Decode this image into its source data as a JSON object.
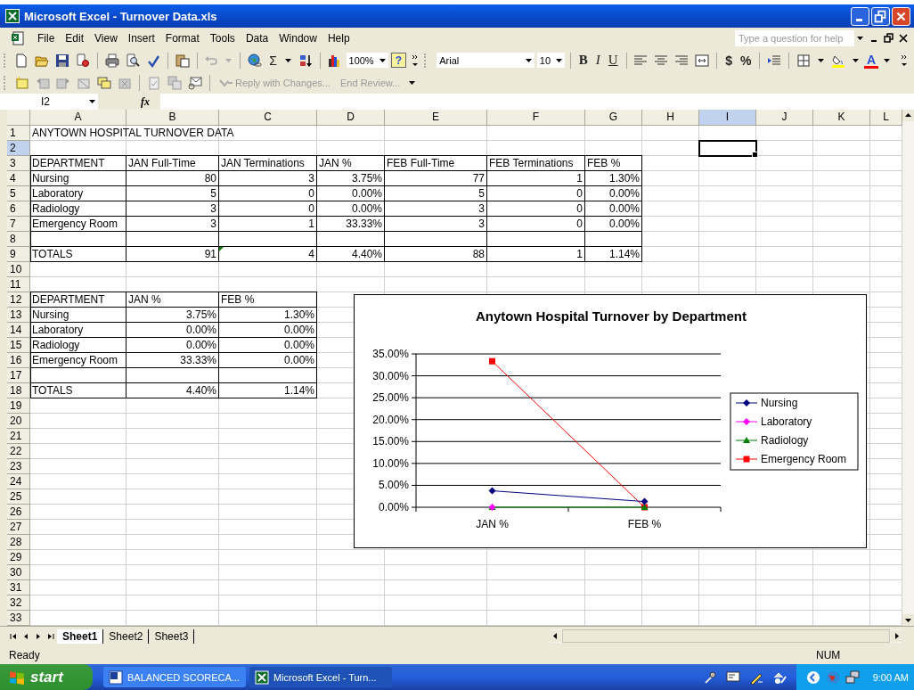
{
  "window": {
    "title": "Microsoft Excel - Turnover Data.xls"
  },
  "menu": [
    "File",
    "Edit",
    "View",
    "Insert",
    "Format",
    "Tools",
    "Data",
    "Window",
    "Help"
  ],
  "help_box": {
    "placeholder": "Type a question for help"
  },
  "standard_toolbar": {
    "sum_glyph": "Σ",
    "zoom": "100%",
    "help_glyph": "?"
  },
  "formatting_toolbar": {
    "font": "Arial",
    "size": "10",
    "bold_glyph": "B",
    "italic_glyph": "I",
    "underline_glyph": "U",
    "currency_glyph": "$",
    "percent_glyph": "%",
    "font_color_glyph": "A"
  },
  "reviewing_toolbar": {
    "buttons": [
      {
        "label": "Reply with Changes...",
        "disabled": true
      },
      {
        "label": "End Review...",
        "disabled": true
      }
    ]
  },
  "formula_bar": {
    "name_box": "I2",
    "fx": "fx"
  },
  "columns": [
    {
      "label": "A",
      "selected": false
    },
    {
      "label": "B",
      "selected": false
    },
    {
      "label": "C",
      "selected": false
    },
    {
      "label": "D",
      "selected": false
    },
    {
      "label": "E",
      "selected": false
    },
    {
      "label": "F",
      "selected": false
    },
    {
      "label": "G",
      "selected": false
    },
    {
      "label": "H",
      "selected": false
    },
    {
      "label": "I",
      "selected": true
    },
    {
      "label": "J",
      "selected": false
    },
    {
      "label": "K",
      "selected": false
    },
    {
      "label": "L",
      "selected": false
    }
  ],
  "rows": [
    {
      "number": "1",
      "selected": false,
      "bordered": false,
      "cells": [
        {
          "value": "ANYTOWN HOSPITAL TURNOVER DATA",
          "kind": "text"
        }
      ]
    },
    {
      "number": "2",
      "selected": true,
      "bordered": false
    },
    {
      "number": "3",
      "selected": false,
      "bordered": true,
      "cells": [
        {
          "value": "DEPARTMENT",
          "kind": "text"
        },
        {
          "value": "JAN Full-Time",
          "kind": "text"
        },
        {
          "value": "JAN Terminations",
          "kind": "text"
        },
        {
          "value": "JAN %",
          "kind": "text"
        },
        {
          "value": "FEB Full-Time",
          "kind": "text"
        },
        {
          "value": "FEB Terminations",
          "kind": "text"
        },
        {
          "value": "FEB %",
          "kind": "text"
        }
      ]
    },
    {
      "number": "4",
      "selected": false,
      "bordered": true,
      "cells": [
        {
          "value": "Nursing",
          "kind": "text"
        },
        {
          "value": "80",
          "kind": "number"
        },
        {
          "value": "3",
          "kind": "number"
        },
        {
          "value": "3.75%",
          "kind": "number"
        },
        {
          "value": "77",
          "kind": "number"
        },
        {
          "value": "1",
          "kind": "number"
        },
        {
          "value": "1.30%",
          "kind": "number"
        }
      ]
    },
    {
      "number": "5",
      "selected": false,
      "bordered": true,
      "cells": [
        {
          "value": "Laboratory",
          "kind": "text"
        },
        {
          "value": "5",
          "kind": "number"
        },
        {
          "value": "0",
          "kind": "number"
        },
        {
          "value": "0.00%",
          "kind": "number"
        },
        {
          "value": "5",
          "kind": "number"
        },
        {
          "value": "0",
          "kind": "number"
        },
        {
          "value": "0.00%",
          "kind": "number"
        }
      ]
    },
    {
      "number": "6",
      "selected": false,
      "bordered": true,
      "cells": [
        {
          "value": "Radiology",
          "kind": "text"
        },
        {
          "value": "3",
          "kind": "number"
        },
        {
          "value": "0",
          "kind": "number"
        },
        {
          "value": "0.00%",
          "kind": "number"
        },
        {
          "value": "3",
          "kind": "number"
        },
        {
          "value": "0",
          "kind": "number"
        },
        {
          "value": "0.00%",
          "kind": "number"
        }
      ]
    },
    {
      "number": "7",
      "selected": false,
      "bordered": true,
      "cells": [
        {
          "value": "Emergency Room",
          "kind": "text"
        },
        {
          "value": "3",
          "kind": "number"
        },
        {
          "value": "1",
          "kind": "number"
        },
        {
          "value": "33.33%",
          "kind": "number"
        },
        {
          "value": "3",
          "kind": "number"
        },
        {
          "value": "0",
          "kind": "number"
        },
        {
          "value": "0.00%",
          "kind": "number"
        }
      ]
    },
    {
      "number": "8",
      "selected": false,
      "bordered": true
    },
    {
      "number": "9",
      "selected": false,
      "bordered": true,
      "cells": [
        {
          "value": "TOTALS",
          "kind": "text"
        },
        {
          "value": "91",
          "kind": "number"
        },
        {
          "value": "4",
          "kind": "number",
          "error_flag": true
        },
        {
          "value": "4.40%",
          "kind": "number"
        },
        {
          "value": "88",
          "kind": "number"
        },
        {
          "value": "1",
          "kind": "number"
        },
        {
          "value": "1.14%",
          "kind": "number"
        }
      ]
    },
    {
      "number": "10",
      "selected": false,
      "bordered": false
    },
    {
      "number": "11",
      "selected": false,
      "bordered": false
    },
    {
      "number": "12",
      "selected": false,
      "bordered": true,
      "cells": [
        {
          "value": "DEPARTMENT",
          "kind": "text"
        },
        {
          "value": "JAN %",
          "kind": "text"
        },
        {
          "value": "FEB %",
          "kind": "text"
        }
      ]
    },
    {
      "number": "13",
      "selected": false,
      "bordered": true,
      "cells": [
        {
          "value": "Nursing",
          "kind": "text"
        },
        {
          "value": "3.75%",
          "kind": "number"
        },
        {
          "value": "1.30%",
          "kind": "number"
        }
      ]
    },
    {
      "number": "14",
      "selected": false,
      "bordered": true,
      "cells": [
        {
          "value": "Laboratory",
          "kind": "text"
        },
        {
          "value": "0.00%",
          "kind": "number"
        },
        {
          "value": "0.00%",
          "kind": "number"
        }
      ]
    },
    {
      "number": "15",
      "selected": false,
      "bordered": true,
      "cells": [
        {
          "value": "Radiology",
          "kind": "text"
        },
        {
          "value": "0.00%",
          "kind": "number"
        },
        {
          "value": "0.00%",
          "kind": "number"
        }
      ]
    },
    {
      "number": "16",
      "selected": false,
      "bordered": true,
      "cells": [
        {
          "value": "Emergency Room",
          "kind": "text"
        },
        {
          "value": "33.33%",
          "kind": "number"
        },
        {
          "value": "0.00%",
          "kind": "number"
        }
      ]
    },
    {
      "number": "17",
      "selected": false,
      "bordered": true
    },
    {
      "number": "18",
      "selected": false,
      "bordered": true,
      "cells": [
        {
          "value": "TOTALS",
          "kind": "text"
        },
        {
          "value": "4.40%",
          "kind": "number"
        },
        {
          "value": "1.14%",
          "kind": "number"
        }
      ]
    },
    {
      "number": "19",
      "selected": false,
      "bordered": false
    },
    {
      "number": "20",
      "selected": false,
      "bordered": false
    },
    {
      "number": "21",
      "selected": false,
      "bordered": false
    },
    {
      "number": "22",
      "selected": false,
      "bordered": false
    },
    {
      "number": "23",
      "selected": false,
      "bordered": false
    },
    {
      "number": "24",
      "selected": false,
      "bordered": false
    },
    {
      "number": "25",
      "selected": false,
      "bordered": false
    },
    {
      "number": "26",
      "selected": false,
      "bordered": false
    },
    {
      "number": "27",
      "selected": false,
      "bordered": false
    },
    {
      "number": "28",
      "selected": false,
      "bordered": false
    },
    {
      "number": "29",
      "selected": false,
      "bordered": false
    },
    {
      "number": "30",
      "selected": false,
      "bordered": false
    },
    {
      "number": "31",
      "selected": false,
      "bordered": false
    },
    {
      "number": "32",
      "selected": false,
      "bordered": false
    },
    {
      "number": "33",
      "selected": false,
      "bordered": false
    }
  ],
  "chart": {
    "chart_data": {
      "type": "line",
      "title": "Anytown Hospital Turnover by Department",
      "categories": [
        "JAN %",
        "FEB %"
      ],
      "series": [
        {
          "name": "Nursing",
          "color": "#000080",
          "marker": "diamond",
          "values": [
            3.75,
            1.3
          ]
        },
        {
          "name": "Laboratory",
          "color": "#ff00ff",
          "marker": "diamond",
          "values": [
            0,
            null
          ]
        },
        {
          "name": "Radiology",
          "color": "#008000",
          "marker": "triangle",
          "values": [
            0,
            0
          ]
        },
        {
          "name": "Emergency Room",
          "color": "#ff0000",
          "marker": "square",
          "values": [
            33.33,
            0
          ]
        }
      ],
      "ylim": [
        0,
        35
      ],
      "yticks": [
        {
          "value": 0,
          "label": "0.00%"
        },
        {
          "value": 5,
          "label": "5.00%"
        },
        {
          "value": 10,
          "label": "10.00%"
        },
        {
          "value": 15,
          "label": "15.00%"
        },
        {
          "value": 20,
          "label": "20.00%"
        },
        {
          "value": 25,
          "label": "25.00%"
        },
        {
          "value": 30,
          "label": "30.00%"
        },
        {
          "value": 35,
          "label": "35.00%"
        }
      ],
      "grid": true,
      "legend": true
    }
  },
  "sheet_tabs": [
    {
      "label": "Sheet1",
      "selected": true
    },
    {
      "label": "Sheet2",
      "selected": false
    },
    {
      "label": "Sheet3",
      "selected": false
    }
  ],
  "status_bar": {
    "message": "Ready",
    "indicator": "NUM"
  },
  "taskbar": {
    "start": "start",
    "tasks": [
      {
        "label": "BALANCED SCORECA...",
        "kind": "word",
        "selected": false
      },
      {
        "label": "Microsoft Excel - Turn...",
        "kind": "excel",
        "selected": true
      }
    ],
    "clock": "9:00 AM"
  }
}
